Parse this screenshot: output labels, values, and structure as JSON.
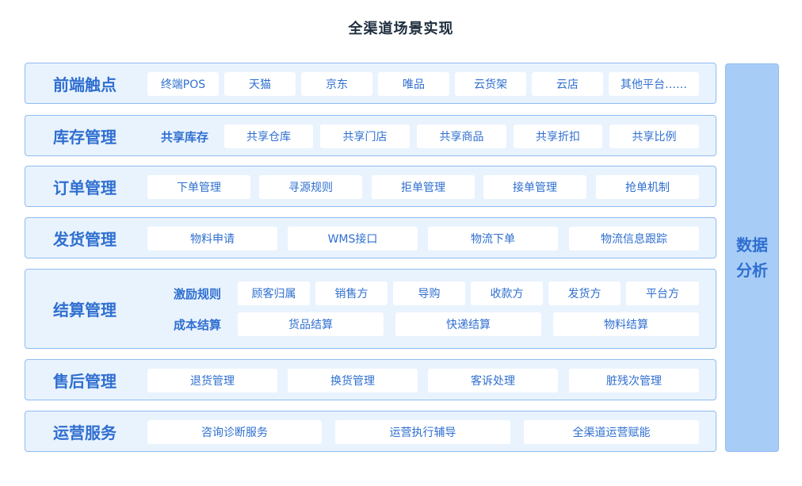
{
  "title": "全渠道场景实现",
  "side_label": "数据分析",
  "rows": {
    "touchpoints": {
      "label": "前端触点",
      "items": [
        "终端POS",
        "天猫",
        "京东",
        "唯品",
        "云货架",
        "云店",
        "其他平台……"
      ]
    },
    "inventory": {
      "label": "库存管理",
      "sublabel": "共享库存",
      "items": [
        "共享仓库",
        "共享门店",
        "共享商品",
        "共享折扣",
        "共享比例"
      ]
    },
    "orders": {
      "label": "订单管理",
      "items": [
        "下单管理",
        "寻源规则",
        "拒单管理",
        "接单管理",
        "抢单机制"
      ]
    },
    "shipping": {
      "label": "发货管理",
      "items": [
        "物料申请",
        "WMS接口",
        "物流下单",
        "物流信息跟踪"
      ]
    },
    "settlement": {
      "label": "结算管理",
      "incentive_label": "激励规则",
      "incentive_items": [
        "顾客归属",
        "销售方",
        "导购",
        "收款方",
        "发货方",
        "平台方"
      ],
      "cost_label": "成本结算",
      "cost_items": [
        "货品结算",
        "快递结算",
        "物料结算"
      ]
    },
    "aftersales": {
      "label": "售后管理",
      "items": [
        "退货管理",
        "换货管理",
        "客诉处理",
        "脏残次管理"
      ]
    },
    "operations": {
      "label": "运营服务",
      "items": [
        "咨询诊断服务",
        "运营执行辅导",
        "全渠道运营赋能"
      ]
    }
  }
}
